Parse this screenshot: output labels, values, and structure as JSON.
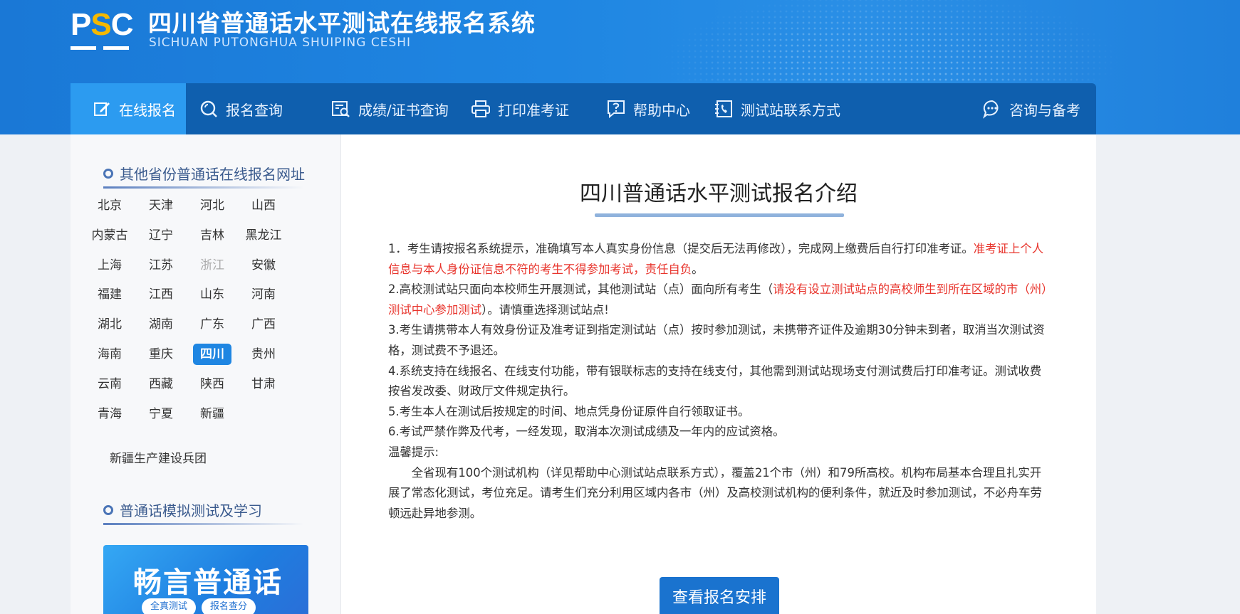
{
  "header": {
    "logo_text": "PSC",
    "title": "四川省普通话水平测试在线报名系统",
    "subtitle": "SICHUAN PUTONGHUA SHUIPING CESHI"
  },
  "nav": [
    {
      "label": "在线报名",
      "icon": "edit-icon",
      "active": true
    },
    {
      "label": "报名查询",
      "icon": "search-icon"
    },
    {
      "label": "成绩/证书查询",
      "icon": "certificate-search-icon"
    },
    {
      "label": "打印准考证",
      "icon": "printer-icon"
    },
    {
      "label": "帮助中心",
      "icon": "help-icon"
    },
    {
      "label": "测试站联系方式",
      "icon": "contact-icon"
    },
    {
      "label": "咨询与备考",
      "icon": "chat-icon"
    }
  ],
  "sidebar": {
    "provinces_heading": "其他省份普通话在线报名网址",
    "provinces": [
      [
        "北京",
        "天津",
        "河北",
        "山西"
      ],
      [
        "内蒙古",
        "辽宁",
        "吉林",
        "黑龙江"
      ],
      [
        "上海",
        "江苏",
        "浙江",
        "安徽"
      ],
      [
        "福建",
        "江西",
        "山东",
        "河南"
      ],
      [
        "湖北",
        "湖南",
        "广东",
        "广西"
      ],
      [
        "海南",
        "重庆",
        "四川",
        "贵州"
      ],
      [
        "云南",
        "西藏",
        "陕西",
        "甘肃"
      ],
      [
        "青海",
        "宁夏",
        "新疆"
      ]
    ],
    "disabled_province": "浙江",
    "active_province": "四川",
    "bingtuan": "新疆生产建设兵团",
    "study_heading": "普通话模拟测试及学习",
    "banner_title": "畅言普通话",
    "banner_pill_1": "全真测试",
    "banner_pill_2": "报名查分"
  },
  "main": {
    "title": "四川普通话水平测试报名介绍",
    "p1_a": "1．考生请按报名系统提示，准确填写本人真实身份信息（提交后无法再修改），完成网上缴费后自行打印准考证。",
    "p1_red": "准考证上个人信息与本人身份证信息不符的考生不得参加考试，责任自负",
    "p1_b": "。",
    "p2_a": "2.高校测试站只面向本校师生开展测试，其他测试站（点）面向所有考生（",
    "p2_red": "请没有设立测试站点的高校师生到所在区域的市（州）测试中心参加测试",
    "p2_b": "）。请慎重选择测试站点!",
    "p3": "3.考生请携带本人有效身份证及准考证到指定测试站（点）按时参加测试，未携带齐证件及逾期30分钟未到者，取消当次测试资格，测试费不予退还。",
    "p4": "4.系统支持在线报名、在线支付功能，带有银联标志的支持在线支付，其他需到测试站现场支付测试费后打印准考证。测试收费按省发改委、财政厅文件规定执行。",
    "p5": "5.考生本人在测试后按规定的时间、地点凭身份证原件自行领取证书。",
    "p6": "6.考试严禁作弊及代考，一经发现，取消本次测试成绩及一年内的应试资格。",
    "tip_label": "温馨提示:",
    "tip_text": "全省现有100个测试机构（详见帮助中心测试站点联系方式），覆盖21个市（州）和79所高校。机构布局基本合理且扎实开展了常态化测试，考位充足。请考生们充分利用区域内各市（州）及高校测试机构的便利条件，就近及时参加测试，不必舟车劳顿远赴异地参测。",
    "button": "查看报名安排"
  },
  "colors": {
    "primary": "#1f86e2",
    "nav_bg": "#0f5fae",
    "nav_active": "#2c9bf0",
    "warning_red": "#e8342c"
  }
}
